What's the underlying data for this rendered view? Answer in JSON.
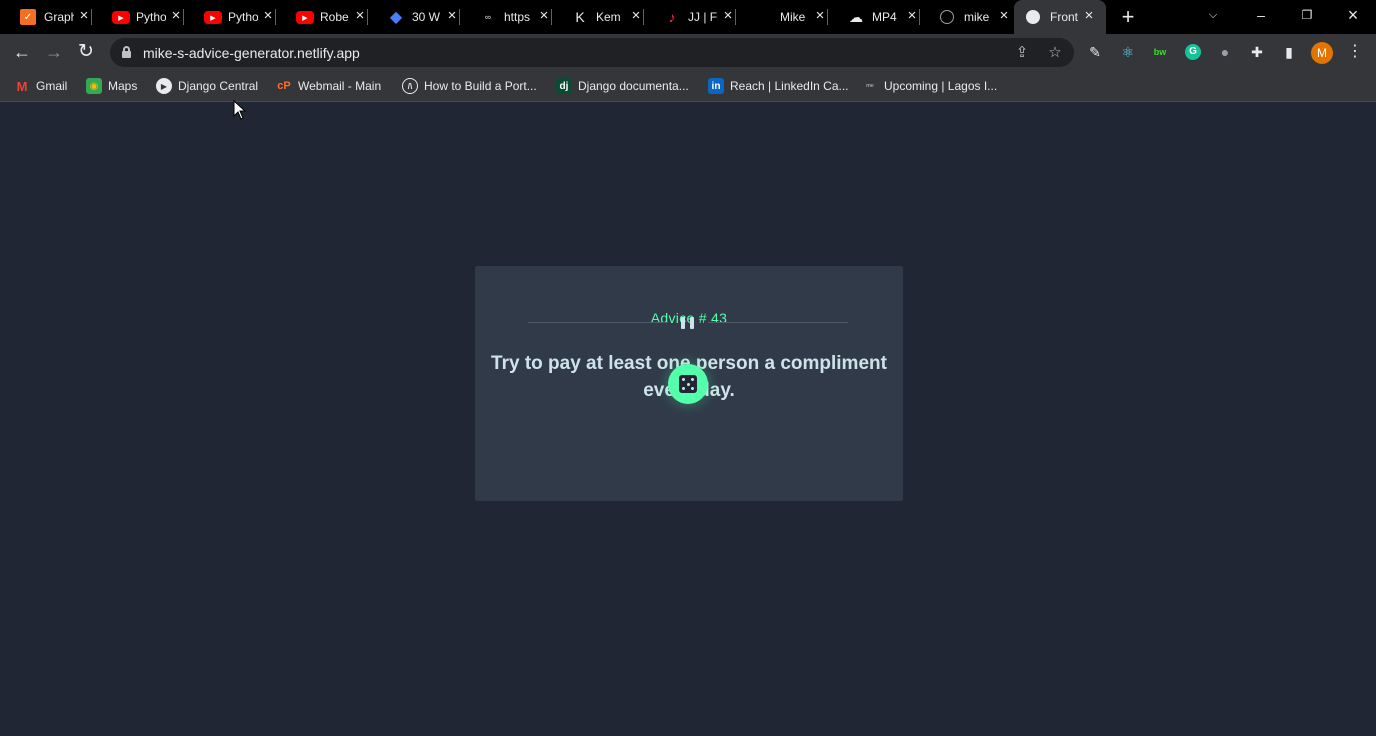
{
  "browser": {
    "tabs": [
      {
        "title": "Graph",
        "icon": "graph-app-icon",
        "color": "#f37021"
      },
      {
        "title": "Pytho",
        "icon": "youtube-icon",
        "color": "#ff0000"
      },
      {
        "title": "Pytho",
        "icon": "youtube-icon",
        "color": "#ff0000"
      },
      {
        "title": "Robe",
        "icon": "youtube-icon",
        "color": "#ff0000"
      },
      {
        "title": "30 W",
        "icon": "diamond-app-icon",
        "color": "#4a7dff"
      },
      {
        "title": "https",
        "icon": "link-icon",
        "color": "#9aa0a6"
      },
      {
        "title": "Kem",
        "icon": "k-logo-icon",
        "color": "#e8eaed"
      },
      {
        "title": "JJ | Fr",
        "icon": "tiktok-icon",
        "color": "#ff2d55"
      },
      {
        "title": "Mike",
        "icon": "blank-icon",
        "color": "#000000"
      },
      {
        "title": "MP4",
        "icon": "cloud-icon",
        "color": "#e8eaed"
      },
      {
        "title": "mike",
        "icon": "globe-icon",
        "color": "#9aa0a6"
      },
      {
        "title": "Front",
        "icon": "page-icon",
        "color": "#e8eaed",
        "active": true
      }
    ],
    "address": {
      "url": "mike-s-advice-generator.netlify.app"
    },
    "profile_initial": "M",
    "bookmarks": [
      {
        "label": "Gmail",
        "icon": "gmail-icon"
      },
      {
        "label": "Maps",
        "icon": "maps-icon"
      },
      {
        "label": "Django Central",
        "icon": "play-circle-icon"
      },
      {
        "label": "Webmail - Main",
        "icon": "cpanel-icon"
      },
      {
        "label": "How to Build a Port...",
        "icon": "code-icon"
      },
      {
        "label": "Django documenta...",
        "icon": "dj-icon"
      },
      {
        "label": "Reach | LinkedIn Ca...",
        "icon": "linkedin-icon"
      },
      {
        "label": "Upcoming | Lagos I...",
        "icon": "meetup-icon"
      }
    ]
  },
  "advice": {
    "id_label": "Advice # 43",
    "text": "Try to pay at least one person a compliment every day."
  },
  "colors": {
    "page_bg": "#202633",
    "card_bg": "#313a49",
    "accent": "#53ffaa",
    "text": "#cee3e9"
  }
}
